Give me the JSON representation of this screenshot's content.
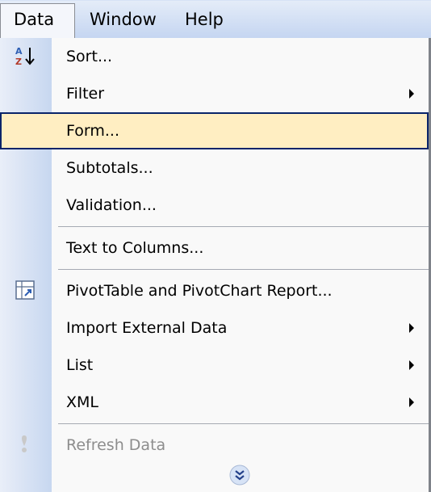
{
  "menubar": {
    "data": "Data",
    "window": "Window",
    "help": "Help"
  },
  "menu": {
    "sort": "Sort...",
    "filter": "Filter",
    "form": "Form...",
    "subtotals": "Subtotals...",
    "validation": "Validation...",
    "text_to_columns": "Text to Columns...",
    "pivot": "PivotTable and PivotChart Report...",
    "import": "Import External Data",
    "list": "List",
    "xml": "XML",
    "refresh": "Refresh Data"
  },
  "icons": {
    "sort": "sort-ascending-icon",
    "pivot": "pivot-table-icon",
    "refresh": "refresh-data-icon",
    "expand": "expand-chevron-icon"
  },
  "colors": {
    "highlight_bg": "#ffeec2",
    "highlight_border": "#0a246a"
  }
}
